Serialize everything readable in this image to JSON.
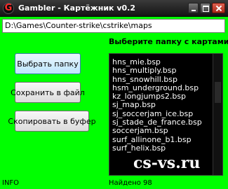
{
  "window": {
    "title": "Gambler - Картёжник v0.2",
    "icon": "g-logo-icon"
  },
  "path": {
    "value": "D:\\Games\\Counter-strike\\cstrike\\maps"
  },
  "buttons": {
    "choose_folder": "Выбрать папку",
    "save_to_file": "Сохранить в файл",
    "copy_to_buffer": "Скопировать в буфер"
  },
  "map_list": {
    "heading": "Выберите папку с картами",
    "items": [
      "hns_mie.bsp",
      "hns_multiply.bsp",
      "hns_snowhill.bsp",
      "hsm_underground.bsp",
      "kz_longjumps2.bsp",
      "sj_map.bsp",
      "sj_soccerjam_ice.bsp",
      "sj_stade_de_france.bsp",
      "soccerjam.bsp",
      "surf_allinone_b1.bsp",
      "surf_helix.bsp"
    ]
  },
  "status": {
    "info": "INFO",
    "found": "Найдено 98"
  },
  "watermark": "cs-vs.ru",
  "colors": {
    "background": "#00ff00",
    "list_bg": "#000000",
    "list_text": "#ffffff"
  }
}
